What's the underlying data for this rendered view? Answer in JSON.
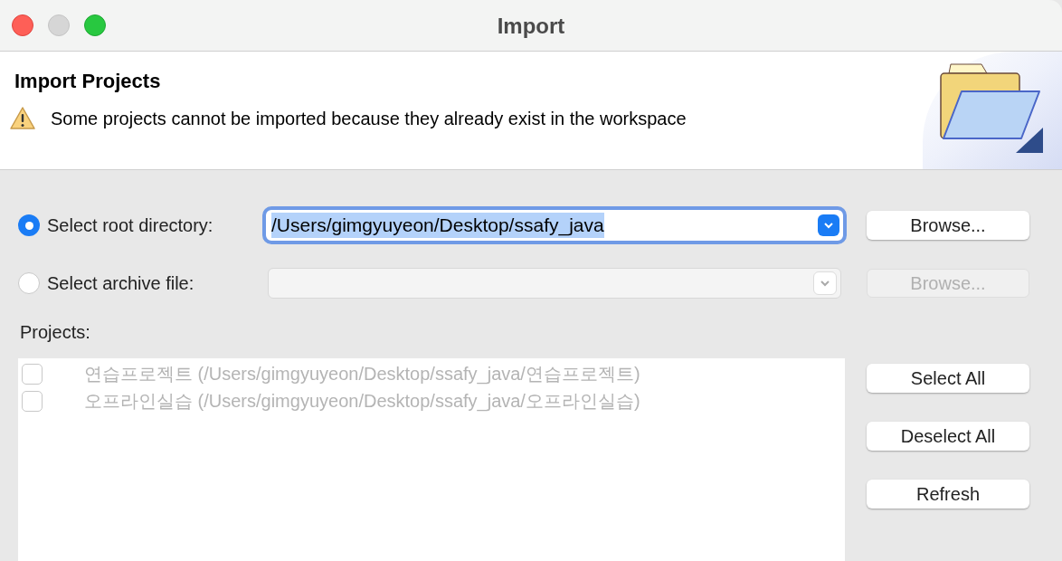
{
  "window": {
    "title": "Import"
  },
  "header": {
    "title": "Import Projects",
    "message": "Some projects cannot be imported because they already exist in the workspace"
  },
  "sources": [
    {
      "label": "Select root directory:",
      "selected": true,
      "value": "/Users/gimgyuyeon/Desktop/ssafy_java",
      "disabled": false,
      "button": "Browse..."
    },
    {
      "label": "Select archive file:",
      "selected": false,
      "disabled": true,
      "button": "Browse..."
    }
  ],
  "projects_label": "Projects:",
  "projects": [
    {
      "label": "연습프로젝트 (/Users/gimgyuyeon/Desktop/ssafy_java/연습프로젝트)",
      "checked": false,
      "disabled": true
    },
    {
      "label": "오프라인실습 (/Users/gimgyuyeon/Desktop/ssafy_java/오프라인실습)",
      "checked": false,
      "disabled": true
    }
  ],
  "buttons": [
    "Select All",
    "Deselect All",
    "Refresh"
  ]
}
